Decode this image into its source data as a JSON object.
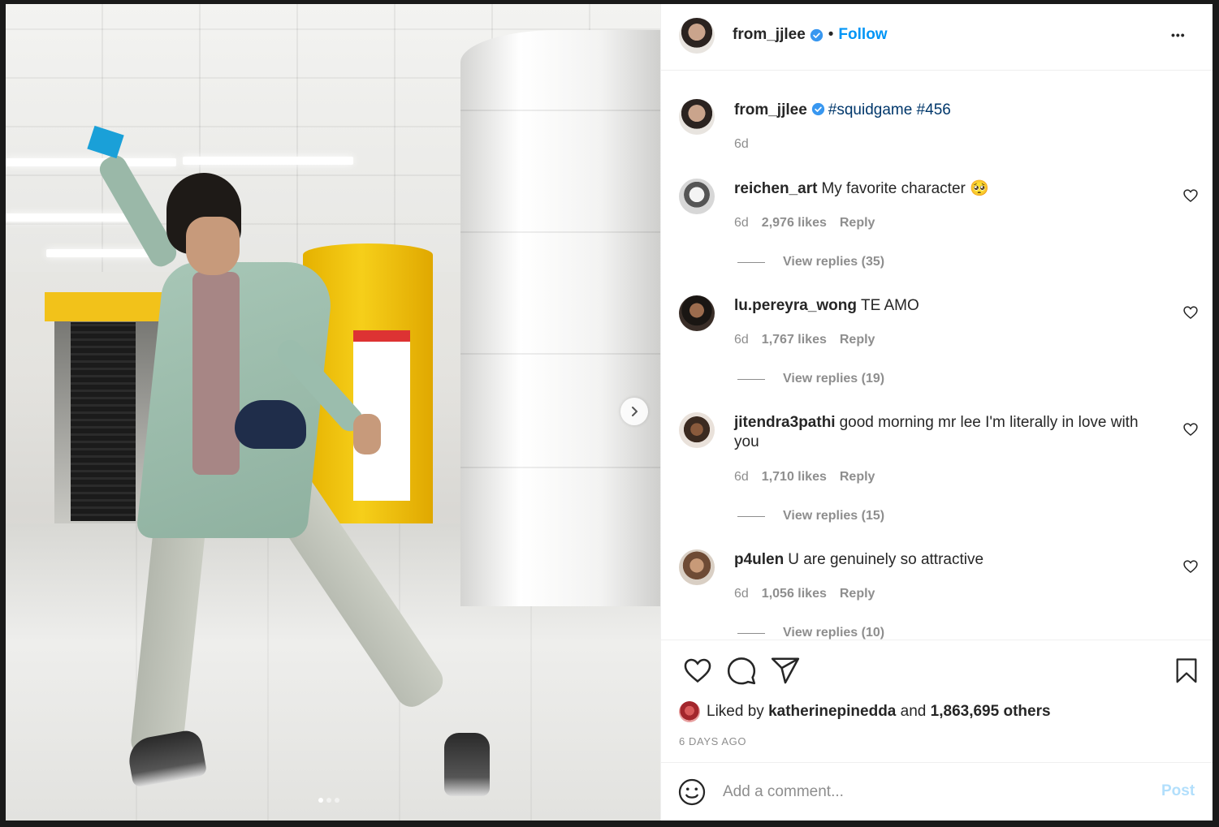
{
  "post": {
    "author": "from_jjlee",
    "follow_label": "Follow",
    "separator": "•",
    "more_label": "•••",
    "caption_hashtags": "#squidgame #456",
    "caption_time": "6d"
  },
  "comments": [
    {
      "user": "reichen_art",
      "text": "My favorite character 🥺",
      "time": "6d",
      "likes": "2,976 likes",
      "reply": "Reply",
      "view_replies": "View replies (35)"
    },
    {
      "user": "lu.pereyra_wong",
      "text": "TE AMO",
      "time": "6d",
      "likes": "1,767 likes",
      "reply": "Reply",
      "view_replies": "View replies (19)"
    },
    {
      "user": "jitendra3pathi",
      "text": "good morning mr lee I'm literally in love with you",
      "time": "6d",
      "likes": "1,710 likes",
      "reply": "Reply",
      "view_replies": "View replies (15)"
    },
    {
      "user": "p4ulen",
      "text": "U are genuinely so attractive",
      "time": "6d",
      "likes": "1,056 likes",
      "reply": "Reply",
      "view_replies": "View replies (10)"
    }
  ],
  "likes_summary": {
    "prefix": "Liked by",
    "user": "katherinepinedda",
    "conj": "and",
    "others": "1,863,695 others"
  },
  "timestamp": "6 DAYS AGO",
  "comment_box": {
    "placeholder": "Add a comment...",
    "post_label": "Post"
  },
  "colors": {
    "accent": "#0095f6",
    "verified": "#3897f0",
    "post_disabled": "#b2dffc",
    "hashtag": "#00376b",
    "muted": "#8e8e8e"
  },
  "icons": [
    "verified-badge-icon",
    "more-options-icon",
    "heart-icon",
    "comment-icon",
    "share-icon",
    "bookmark-icon",
    "emoji-icon",
    "next-arrow-icon"
  ]
}
